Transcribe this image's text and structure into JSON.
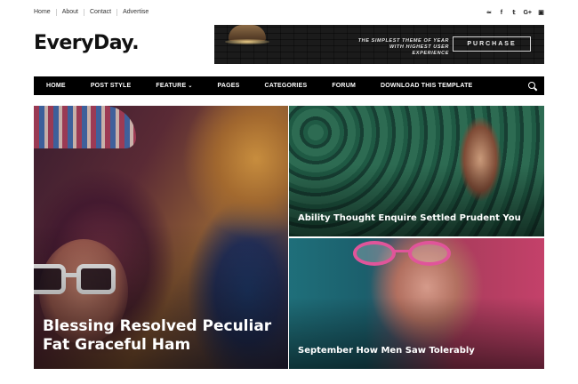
{
  "topbar": {
    "links": [
      "Home",
      "About",
      "Contact",
      "Advertise"
    ],
    "social_icons": [
      "rss-icon",
      "facebook-icon",
      "twitter-icon",
      "google-plus-icon",
      "instagram-icon"
    ]
  },
  "header": {
    "logo": "EveryDay.",
    "banner": {
      "line1": "THE SIMPLEST THEME OF YEAR",
      "line2": "WITH HIGHEST USER EXPERIENCE",
      "button": "PURCHASE"
    }
  },
  "nav": {
    "items": [
      "HOME",
      "POST STYLE",
      "FEATURE",
      "PAGES",
      "CATEGORIES",
      "FORUM",
      "DOWNLOAD THIS TEMPLATE"
    ]
  },
  "featured": {
    "main_title": "Blessing Resolved Peculiar Fat Graceful Ham",
    "side_title_1": "Ability Thought Enquire Settled Prudent You",
    "side_title_2": "September How Men Saw Tolerably"
  },
  "colors": {
    "nav_bg": "#000000",
    "text": "#111111",
    "accent_pink": "#e0559a"
  }
}
